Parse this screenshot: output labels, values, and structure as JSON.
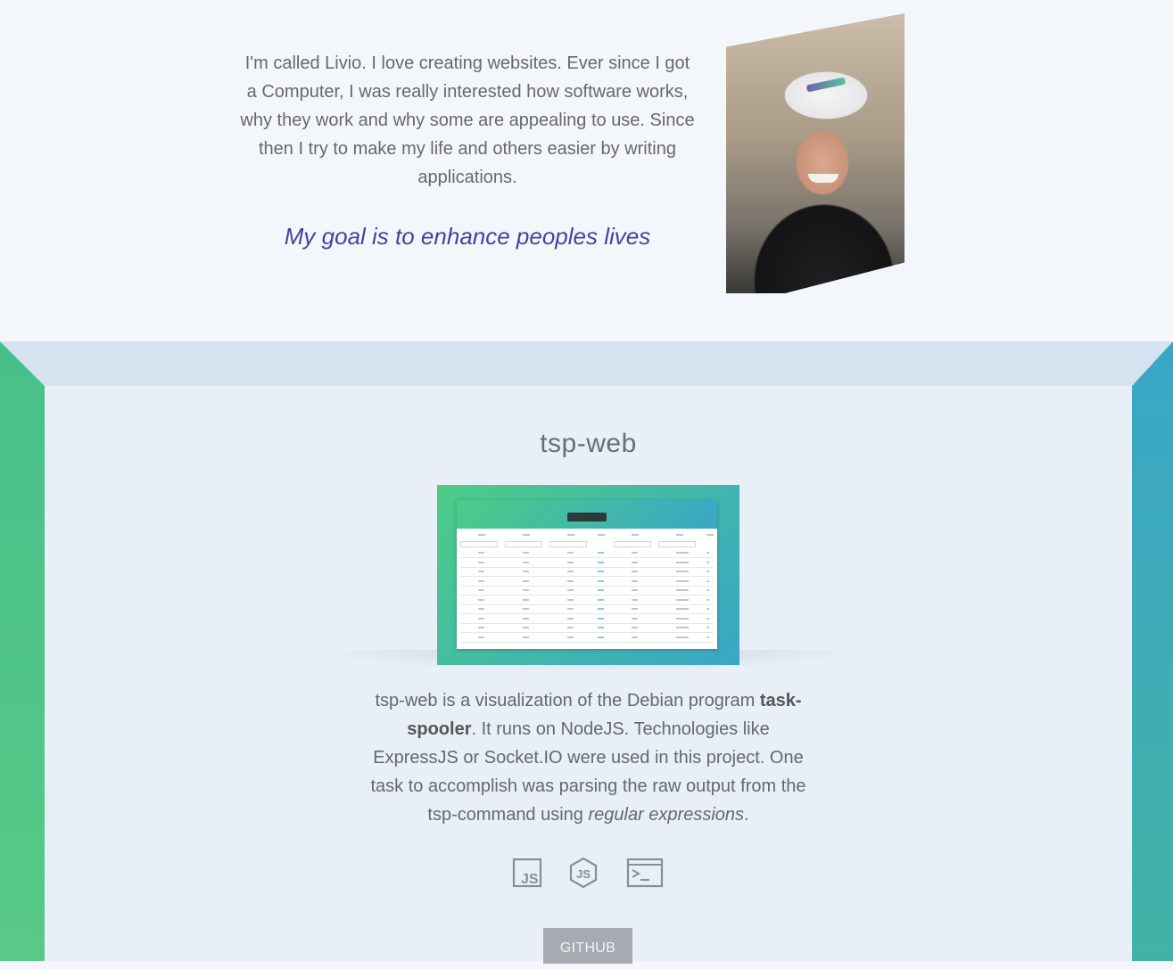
{
  "about": {
    "intro": "I'm called Livio. I love creating websites. Ever since I got a Computer, I was really interested how software works, why they work and why some are appealing to use. Since then I try to make my life and others easier by writing applications.",
    "goal": "My goal is to enhance peoples lives"
  },
  "project": {
    "title": "tsp-web",
    "description": {
      "part1": "tsp-web is a visualization of the Debian program ",
      "bold": "task-spooler",
      "part2": ". It runs on NodeJS. Technologies like ExpressJS or Socket.IO were used in this project. One task to accomplish was parsing the raw output from the tsp-command using ",
      "italic": "regular expressions",
      "part3": "."
    },
    "tech_icons": [
      "javascript-icon",
      "nodejs-icon",
      "terminal-icon"
    ],
    "github_label": "GITHUB"
  },
  "colors": {
    "accent_purple": "#4a3fa0",
    "gradient_green": "#4ccc87",
    "gradient_blue": "#3aa6c7",
    "button_gray": "#a7abb1"
  }
}
